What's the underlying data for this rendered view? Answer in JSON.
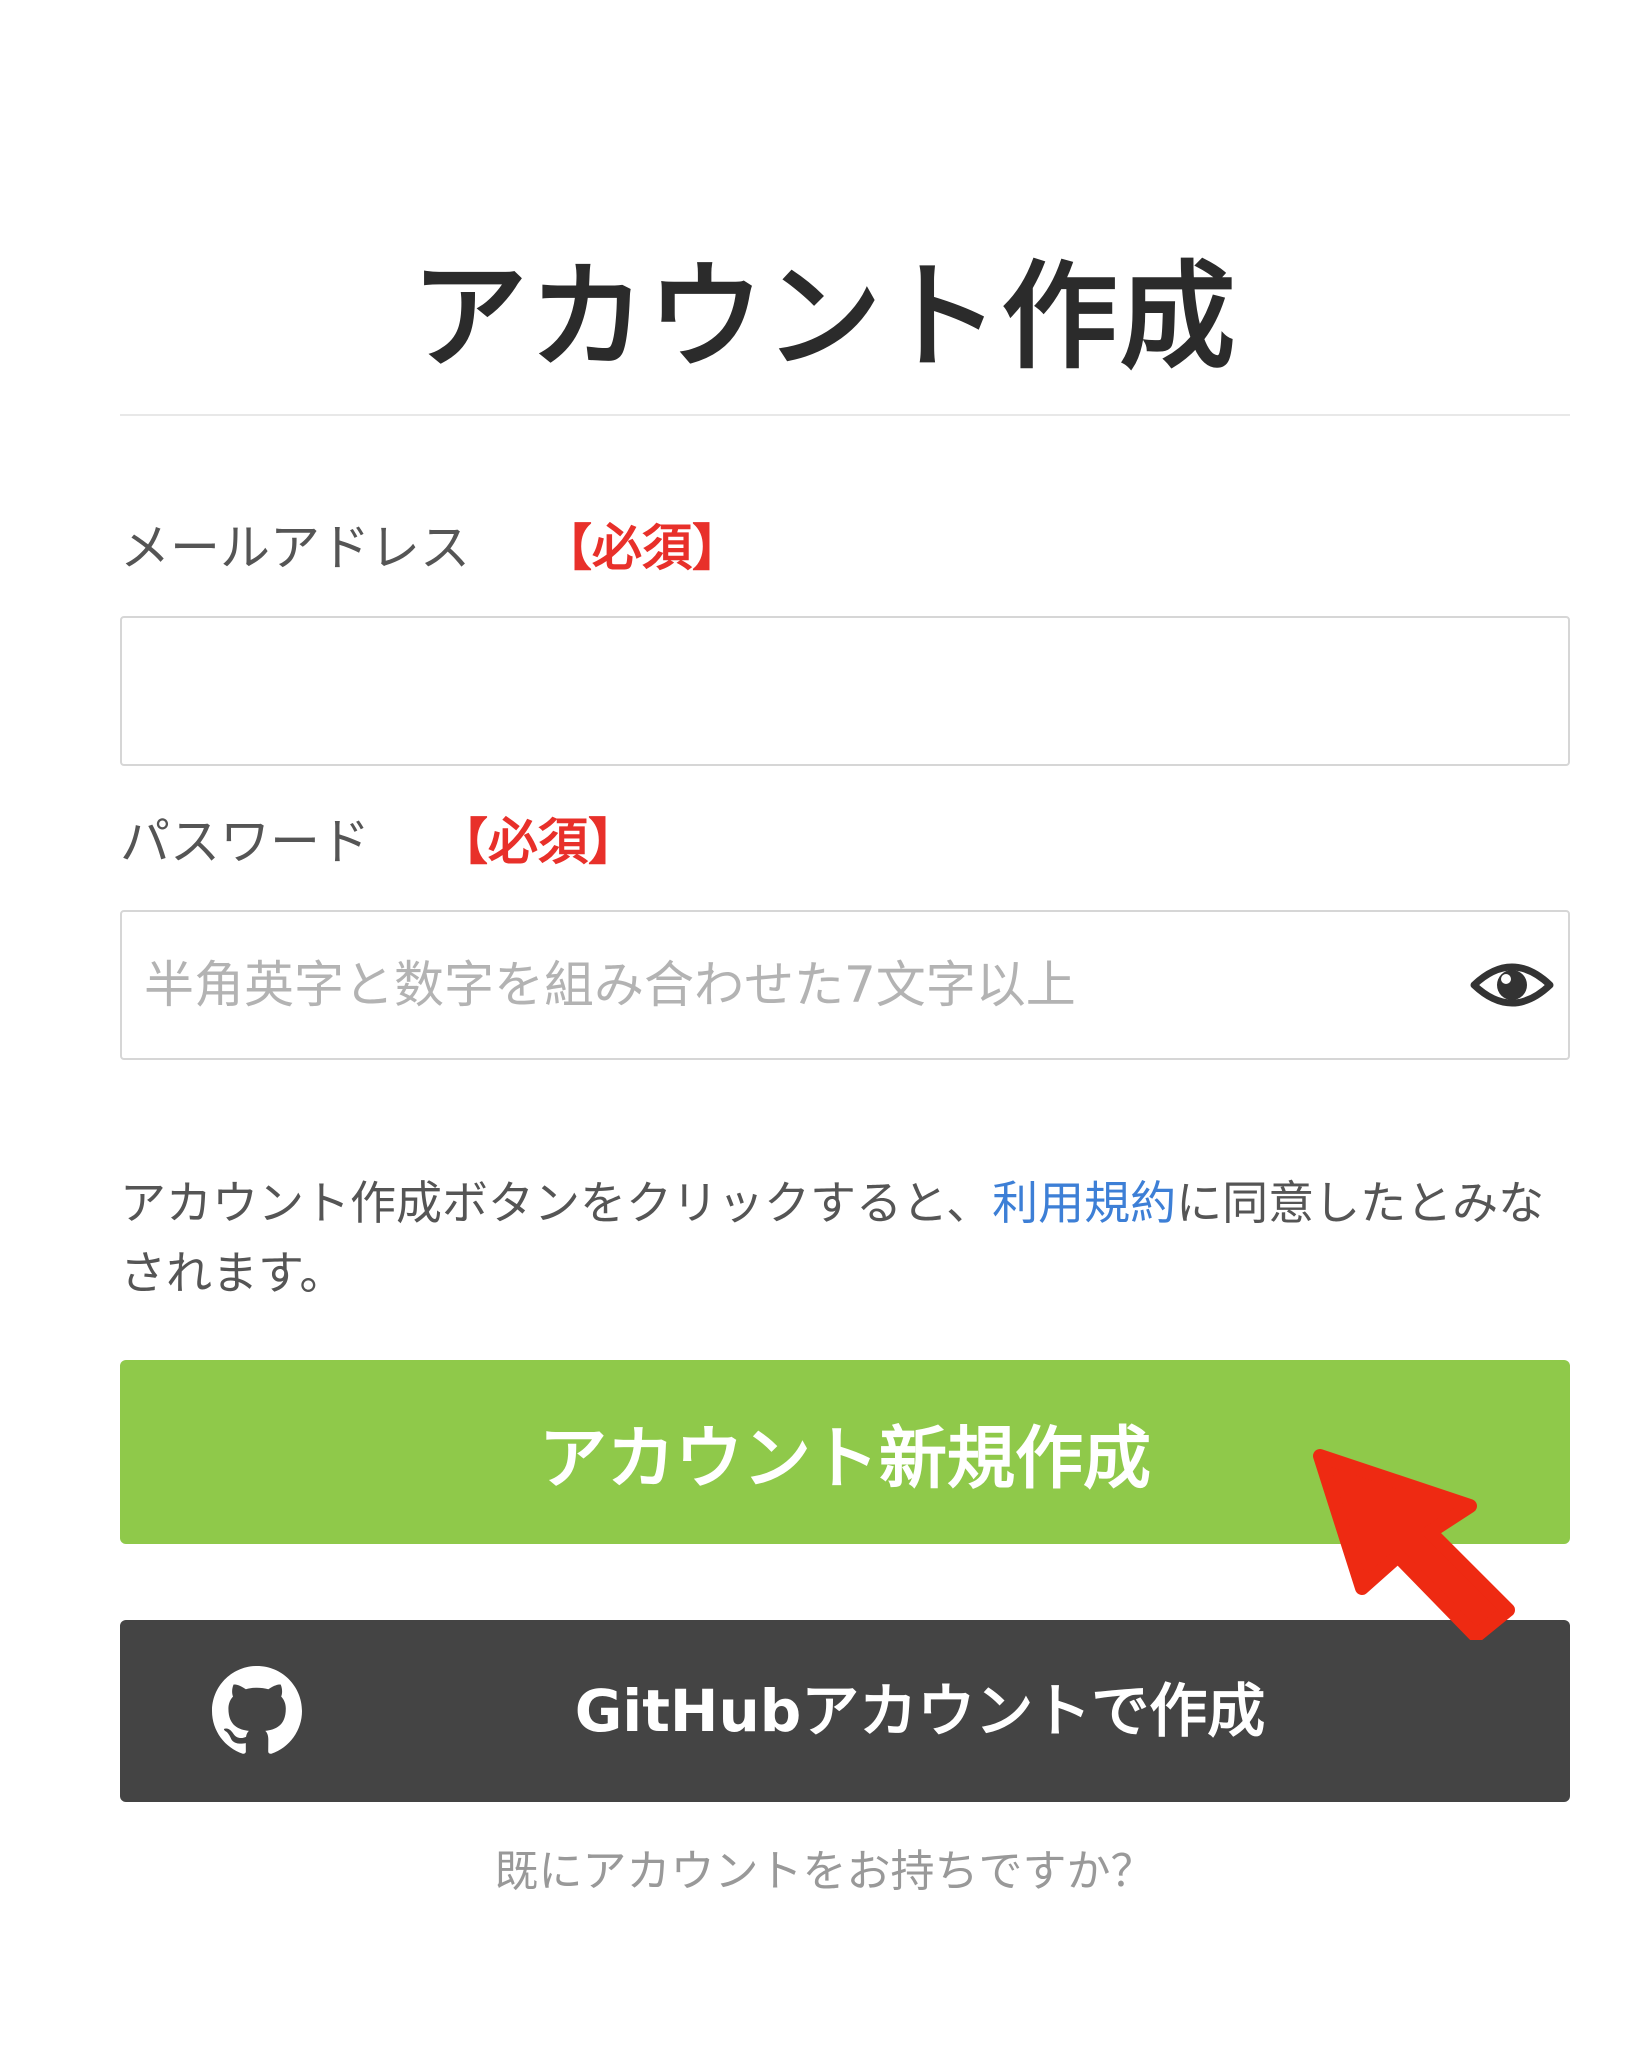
{
  "page": {
    "title": "アカウント作成"
  },
  "email": {
    "label": "メールアドレス",
    "required": "【必須】",
    "value": "",
    "placeholder": ""
  },
  "password": {
    "label": "パスワード",
    "required": "【必須】",
    "value": "",
    "placeholder": "半角英字と数字を組み合わせた7文字以上",
    "toggle_icon": "eye-icon"
  },
  "notice": {
    "before": "アカウント作成ボタンをクリックすると、",
    "terms_link": "利用規約",
    "after": "に同意したとみなされます。"
  },
  "buttons": {
    "create_account": "アカウント新規作成",
    "github": "GitHubアカウントで作成",
    "github_icon": "github-icon"
  },
  "footer": {
    "login_prompt": "既にアカウントをお持ちですか？"
  },
  "colors": {
    "primary_green": "#8fc94a",
    "github_dark": "#444444",
    "required_red": "#e8302a",
    "link_blue": "#3d7fd6",
    "annotation_arrow": "#ee2a12"
  }
}
